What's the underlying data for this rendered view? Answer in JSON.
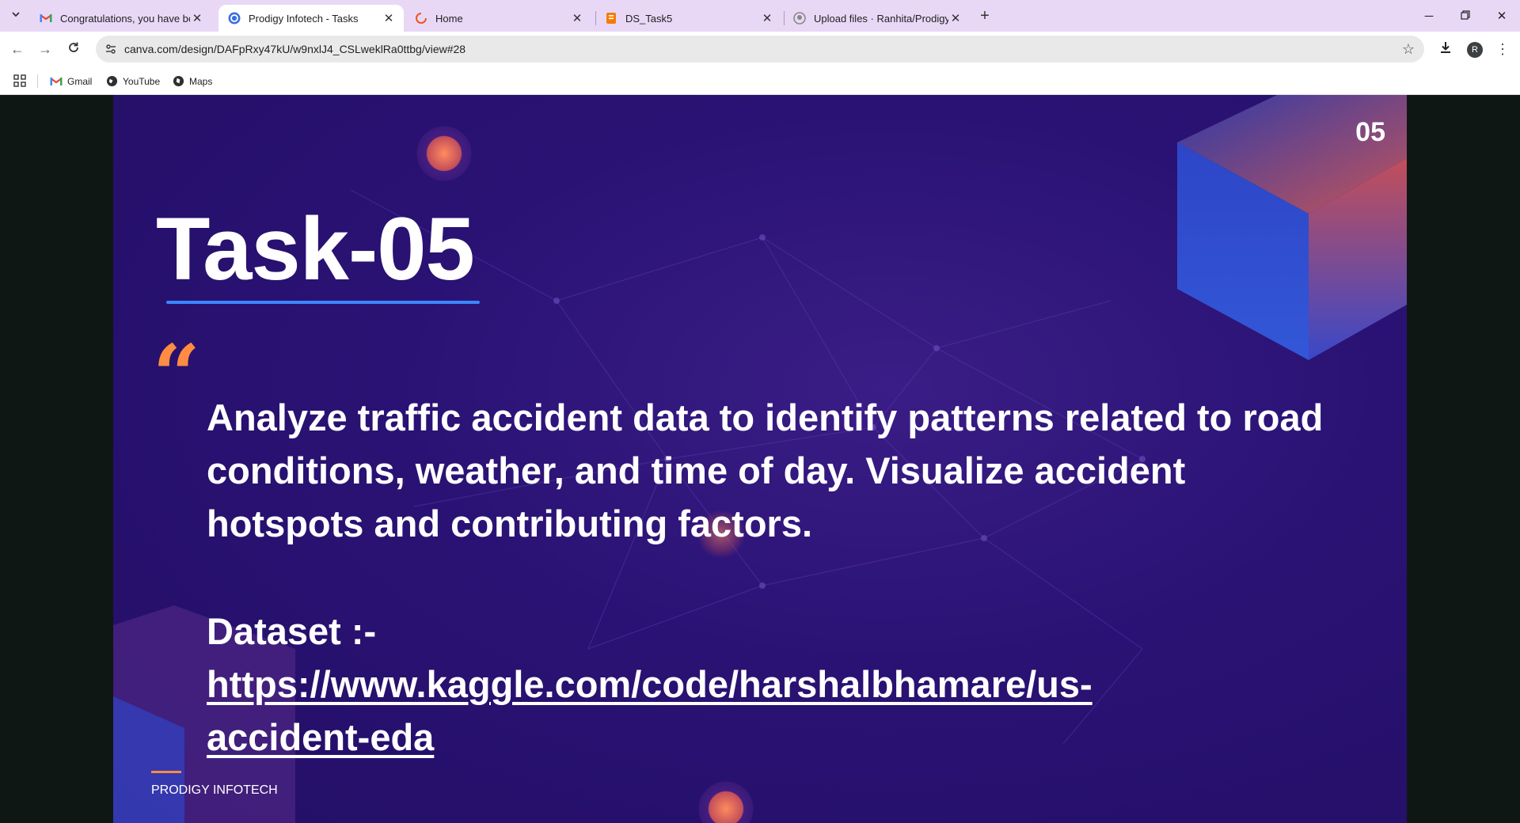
{
  "browser": {
    "tabs": [
      {
        "title": "Congratulations, you have been",
        "favicon": "gmail-icon",
        "active": false
      },
      {
        "title": "Prodigy Infotech - Tasks",
        "favicon": "canva-icon",
        "active": true
      },
      {
        "title": "Home",
        "favicon": "loading-icon",
        "active": false
      },
      {
        "title": "DS_Task5",
        "favicon": "doc-icon",
        "active": false
      },
      {
        "title": "Upload files · Ranhita/Prodigy_I",
        "favicon": "github-icon",
        "active": false
      }
    ],
    "url": "canva.com/design/DAFpRxy47kU/w9nxlJ4_CSLweklRa0ttbg/view#28",
    "avatar_letter": "R",
    "bookmarks": [
      {
        "label": "Gmail"
      },
      {
        "label": "YouTube"
      },
      {
        "label": "Maps"
      }
    ]
  },
  "slide": {
    "page_number": "05",
    "title": "Task-05",
    "description": "Analyze traffic accident data to identify patterns related to road conditions, weather, and time of day. Visualize accident hotspots and contributing factors.",
    "dataset_label": "Dataset :-",
    "dataset_link": "https://www.kaggle.com/code/harshalbhamare/us-accident-eda",
    "brand": "PRODIGY INFOTECH",
    "colors": {
      "background": "#2a1274",
      "accent_orange": "#ff8c42",
      "accent_blue": "#3b86ff"
    }
  }
}
